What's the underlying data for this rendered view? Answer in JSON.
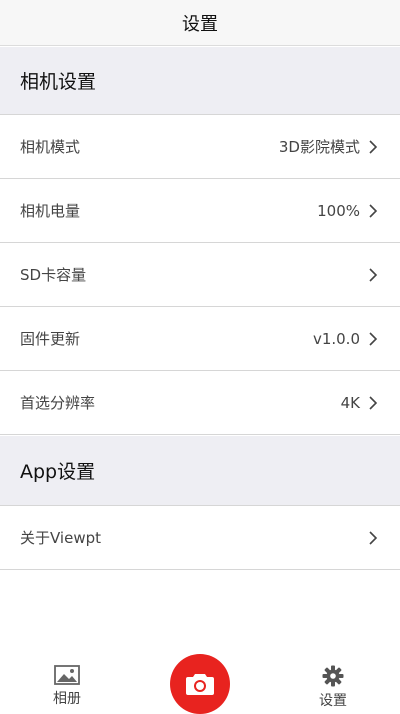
{
  "header": {
    "title": "设置"
  },
  "sections": {
    "camera": {
      "title": "相机设置",
      "items": [
        {
          "label": "相机模式",
          "value": "3D影院模式"
        },
        {
          "label": "相机电量",
          "value": "100%"
        },
        {
          "label": "SD卡容量",
          "value": ""
        },
        {
          "label": "固件更新",
          "value": "v1.0.0"
        },
        {
          "label": "首选分辨率",
          "value": "4K"
        }
      ]
    },
    "app": {
      "title": "App设置",
      "items": [
        {
          "label": "关于Viewpt",
          "value": ""
        }
      ]
    }
  },
  "tabbar": {
    "album_label": "相册",
    "settings_label": "设置",
    "accent_color": "#e8231f",
    "icons": [
      "image-icon",
      "camera-icon",
      "gear-icon"
    ]
  }
}
